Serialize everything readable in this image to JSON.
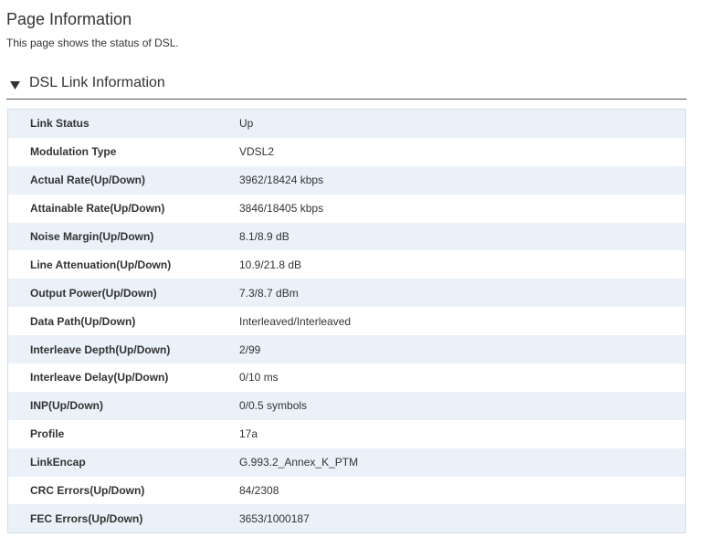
{
  "page": {
    "title": "Page Information",
    "description": "This page shows the status of DSL."
  },
  "section": {
    "title": "DSL Link Information",
    "toggle_icon": "triangle-down-icon"
  },
  "rows": [
    {
      "label": "Link Status",
      "value": "Up"
    },
    {
      "label": "Modulation Type",
      "value": "VDSL2"
    },
    {
      "label": "Actual Rate(Up/Down)",
      "value": "3962/18424 kbps"
    },
    {
      "label": "Attainable Rate(Up/Down)",
      "value": "3846/18405 kbps"
    },
    {
      "label": "Noise Margin(Up/Down)",
      "value": "8.1/8.9 dB"
    },
    {
      "label": "Line Attenuation(Up/Down)",
      "value": "10.9/21.8 dB"
    },
    {
      "label": "Output Power(Up/Down)",
      "value": "7.3/8.7 dBm"
    },
    {
      "label": "Data Path(Up/Down)",
      "value": "Interleaved/Interleaved"
    },
    {
      "label": "Interleave Depth(Up/Down)",
      "value": "2/99"
    },
    {
      "label": "Interleave Delay(Up/Down)",
      "value": "0/10 ms"
    },
    {
      "label": "INP(Up/Down)",
      "value": "0/0.5 symbols"
    },
    {
      "label": "Profile",
      "value": "17a"
    },
    {
      "label": "LinkEncap",
      "value": "G.993.2_Annex_K_PTM"
    },
    {
      "label": "CRC Errors(Up/Down)",
      "value": "84/2308"
    },
    {
      "label": "FEC Errors(Up/Down)",
      "value": "3653/1000187"
    }
  ],
  "colors": {
    "row_stripe": "#eaf1f8",
    "table_border": "#d3dde8",
    "text": "#333333"
  }
}
